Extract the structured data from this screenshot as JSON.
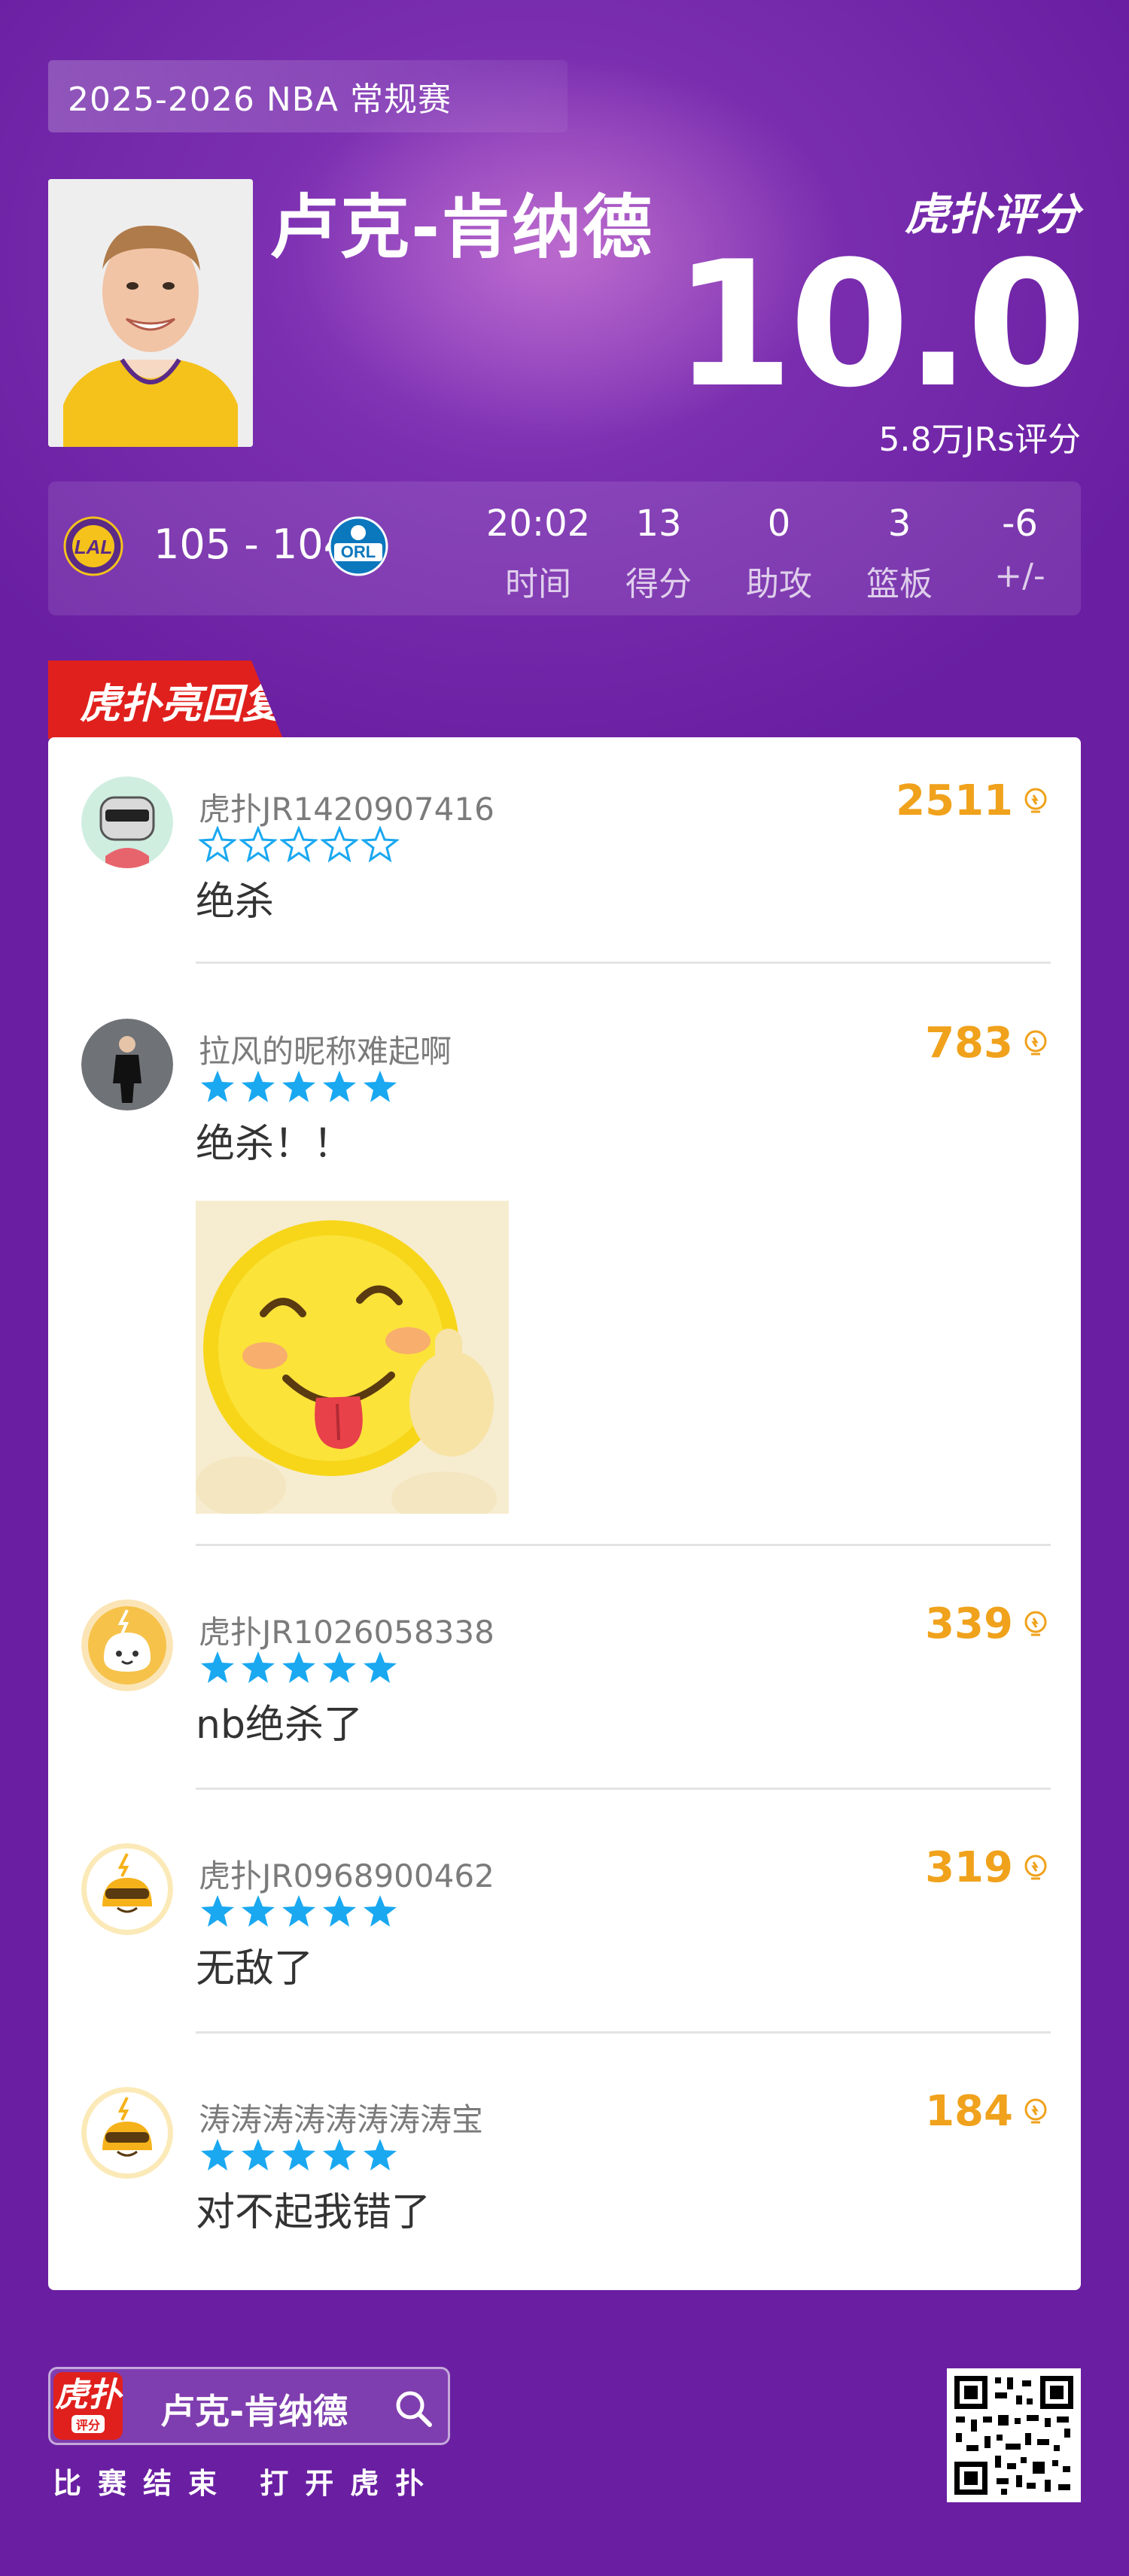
{
  "header": {
    "season": "2025-2026 NBA 常规赛",
    "player_name": "卢克-肯纳德",
    "brand": "虎扑评分",
    "rating": "10.0",
    "rating_count": "5.8万JRs评分"
  },
  "game": {
    "home_team_logo": "LAL",
    "away_team_logo": "ORL",
    "final_score": "105 - 104",
    "stats": [
      {
        "value": "20:02",
        "label": "时间"
      },
      {
        "value": "13",
        "label": "得分"
      },
      {
        "value": "0",
        "label": "助攻"
      },
      {
        "value": "3",
        "label": "篮板"
      },
      {
        "value": "-6",
        "label": "+/-"
      }
    ]
  },
  "section_tag": "虎扑亮回复",
  "comments": [
    {
      "user": "虎扑JR1420907416",
      "stars": 0,
      "likes": "2511",
      "text": "绝杀",
      "avatar": "robot-avatar"
    },
    {
      "user": "拉风的昵称难起啊",
      "stars": 5,
      "likes": "783",
      "text": "绝杀！！",
      "avatar": "photo-avatar",
      "has_image": true
    },
    {
      "user": "虎扑JR1026058338",
      "stars": 5,
      "likes": "339",
      "text": "nb绝杀了",
      "avatar": "bulb-avatar"
    },
    {
      "user": "虎扑JR0968900462",
      "stars": 5,
      "likes": "319",
      "text": "无敌了",
      "avatar": "sunglasses-avatar"
    },
    {
      "user": "涛涛涛涛涛涛涛涛宝",
      "stars": 5,
      "likes": "184",
      "text": "对不起我错了",
      "avatar": "sunglasses-avatar"
    }
  ],
  "footer": {
    "app_icon_main": "虎扑",
    "app_icon_sub": "评分",
    "search_text": "卢克-肯纳德",
    "caption": "比赛结束 打开虎扑"
  },
  "colors": {
    "background": "#6a1fa2",
    "accent_red": "#e0201d",
    "likes_orange": "#f0a21c",
    "star_blue": "#1aa8f0"
  }
}
